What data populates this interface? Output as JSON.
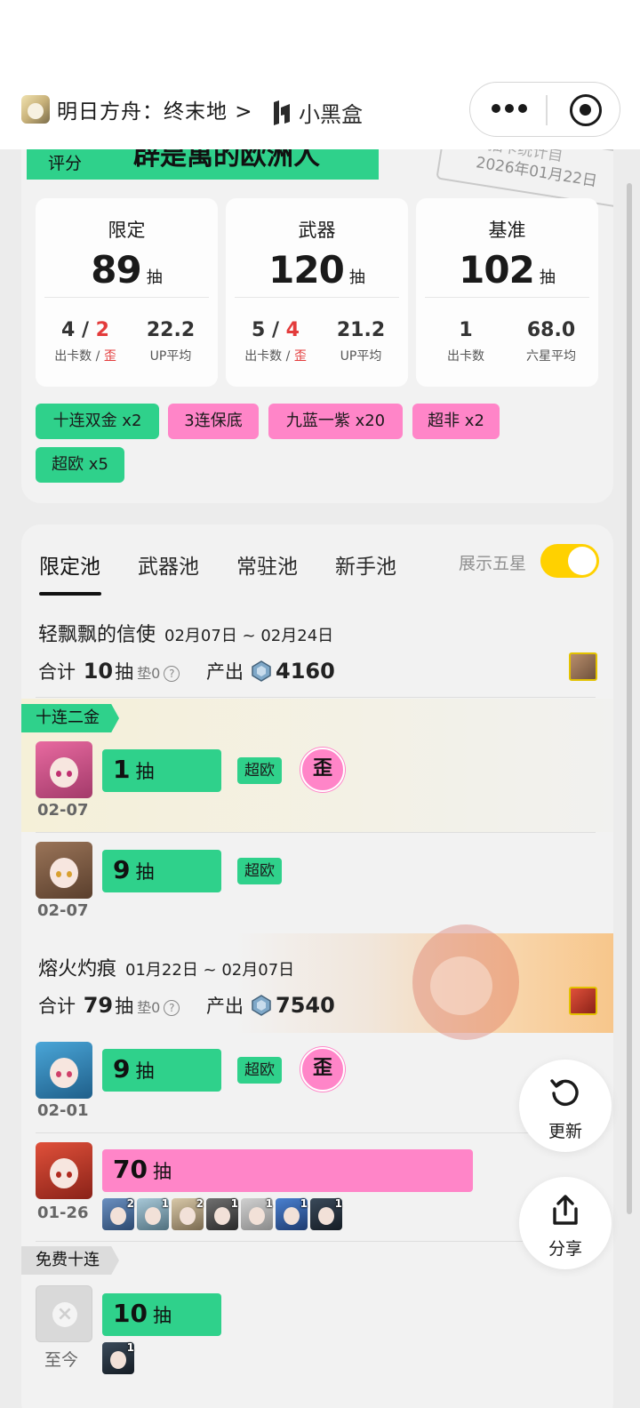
{
  "navbar": {
    "app_title": "明日方舟：终末地 >",
    "brand": "小黑盒",
    "more_icon": "more-dots-icon",
    "close_icon": "target-circle-icon"
  },
  "summary": {
    "rating_label": "评分",
    "rating_title": "辟是萬的欧洲人",
    "stamp_line1": "抽卡统计自",
    "stamp_line2": "2026年01月22日",
    "cards": [
      {
        "name": "限定",
        "count": "89",
        "unit": "抽",
        "left_value": "4",
        "left_red": "2",
        "left_label": "出卡数 / ",
        "left_label_red": "歪",
        "right_value": "22.2",
        "right_label": "UP平均"
      },
      {
        "name": "武器",
        "count": "120",
        "unit": "抽",
        "left_value": "5",
        "left_red": "4",
        "left_label": "出卡数 / ",
        "left_label_red": "歪",
        "right_value": "21.2",
        "right_label": "UP平均"
      },
      {
        "name": "基准",
        "count": "102",
        "unit": "抽",
        "left_value": "1",
        "left_label": "出卡数",
        "right_value": "68.0",
        "right_label": "六星平均"
      }
    ],
    "tags": [
      "十连双金 x2",
      "3连保底",
      "九蓝一紫 x20",
      "超非 x2",
      "超欧 x5"
    ]
  },
  "tabs": [
    "限定池",
    "武器池",
    "常驻池",
    "新手池"
  ],
  "show_five_star": {
    "label": "展示五星",
    "on": true
  },
  "pools": [
    {
      "name": "轻飘飘的信使",
      "dates": "02月07日 ~ 02月24日",
      "total_prefix": "合计",
      "total": "10",
      "unit": "抽",
      "pad": "垫0",
      "help": "?",
      "output_label": "产出",
      "output": "4160"
    },
    {
      "name": "熔火灼痕",
      "dates": "01月22日 ~ 02月07日",
      "total_prefix": "合计",
      "total": "79",
      "unit": "抽",
      "pad": "垫0",
      "help": "?",
      "output_label": "产出",
      "output": "7540"
    }
  ],
  "ribbons": {
    "ten_double": "十连二金",
    "free_ten": "免费十连"
  },
  "rows": [
    {
      "pulls": "1",
      "unit": "抽",
      "badge": "超欧",
      "wai": "歪",
      "date": "02-07",
      "fill": 0.27
    },
    {
      "pulls": "9",
      "unit": "抽",
      "badge": "超欧",
      "date": "02-07",
      "fill": 0.27
    },
    {
      "pulls": "9",
      "unit": "抽",
      "badge": "超欧",
      "wai": "歪",
      "date": "02-01",
      "fill": 0.27
    },
    {
      "pulls": "70",
      "unit": "抽",
      "date": "01-26",
      "fill": 0.84,
      "ops": [
        "2",
        "1",
        "2",
        "1",
        "1",
        "1",
        "1"
      ]
    },
    {
      "pulls": "10",
      "unit": "抽",
      "date": "至今",
      "fill": 0.27,
      "ops": [
        "1"
      ]
    }
  ],
  "fab": {
    "refresh": "更新",
    "share": "分享"
  },
  "colors": {
    "green": "#2fd18b",
    "pink": "#ff85c8",
    "red": "#e33b3b",
    "yellow": "#ffd100"
  }
}
